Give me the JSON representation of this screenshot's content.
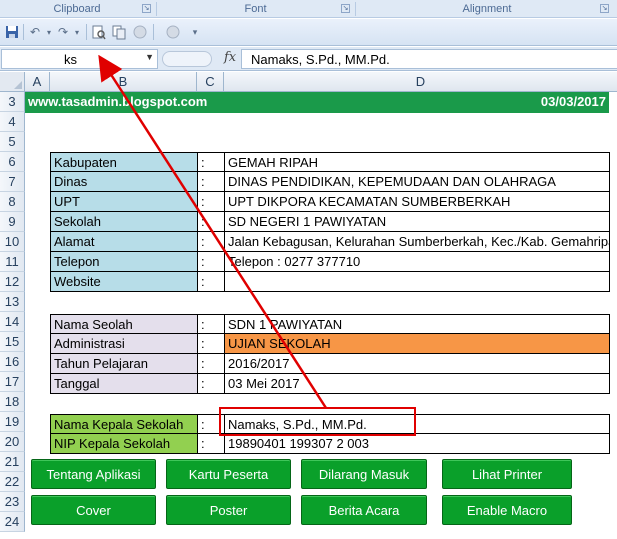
{
  "ribbon": {
    "groups": [
      "Clipboard",
      "Font",
      "Alignment"
    ]
  },
  "qat": {
    "icons": [
      "save-icon",
      "undo-icon",
      "redo-icon",
      "print-preview-icon",
      "copy-icon",
      "circle-icon",
      "circle-icon",
      "customize-icon"
    ]
  },
  "formula_bar": {
    "name_box": "ks",
    "fx_label": "fx",
    "content": "Namaks, S.Pd., MM.Pd."
  },
  "columns": [
    "A",
    "B",
    "C",
    "D"
  ],
  "rows": [
    "3",
    "4",
    "5",
    "6",
    "7",
    "8",
    "9",
    "10",
    "11",
    "12",
    "13",
    "14",
    "15",
    "16",
    "17",
    "18",
    "19",
    "20",
    "21",
    "22",
    "23",
    "24"
  ],
  "banner": {
    "site": "www.tasadmin.blogspot.com",
    "date": "03/03/2017"
  },
  "info_table": [
    {
      "label": "Kabupaten",
      "sep": ":",
      "value": "GEMAH RIPAH"
    },
    {
      "label": "Dinas",
      "sep": ":",
      "value": "DINAS PENDIDIKAN, KEPEMUDAAN DAN OLAHRAGA"
    },
    {
      "label": "UPT",
      "sep": ":",
      "value": "UPT DIKPORA KECAMATAN SUMBERBERKAH"
    },
    {
      "label": "Sekolah",
      "sep": ":",
      "value": "SD NEGERI 1 PAWIYATAN"
    },
    {
      "label": "Alamat",
      "sep": ":",
      "value": "Jalan Kebagusan, Kelurahan Sumberberkah, Kec./Kab. Gemahripah"
    },
    {
      "label": "Telepon",
      "sep": ":",
      "value": "Telepon : 0277 377710"
    },
    {
      "label": "Website",
      "sep": ":",
      "value": ""
    }
  ],
  "exam_table": [
    {
      "label": "Nama Seolah",
      "sep": ":",
      "value": "SDN 1 PAWIYATAN"
    },
    {
      "label": "Administrasi",
      "sep": ":",
      "value": "UJIAN SEKOLAH"
    },
    {
      "label": "Tahun Pelajaran",
      "sep": ":",
      "value": "2016/2017"
    },
    {
      "label": "Tanggal",
      "sep": ":",
      "value": "03 Mei 2017"
    }
  ],
  "principal_table": [
    {
      "label": "Nama Kepala Sekolah",
      "sep": ":",
      "value": "Namaks, S.Pd., MM.Pd."
    },
    {
      "label": "NIP Kepala Sekolah",
      "sep": ":",
      "value": "19890401 199307 2 003"
    }
  ],
  "buttons": [
    "Tentang Aplikasi",
    "Kartu Peserta",
    "Dilarang Masuk",
    "Lihat Printer",
    "Cover",
    "Poster",
    "Berita Acara",
    "Enable Macro"
  ],
  "colors": {
    "banner": "#1a9a4a",
    "label_blue": "#b7dde8",
    "label_lavender": "#e4dfec",
    "label_green": "#92d050",
    "highlight_orange": "#f79646",
    "button_green": "#0aa02a",
    "annotation_red": "#e00000"
  }
}
